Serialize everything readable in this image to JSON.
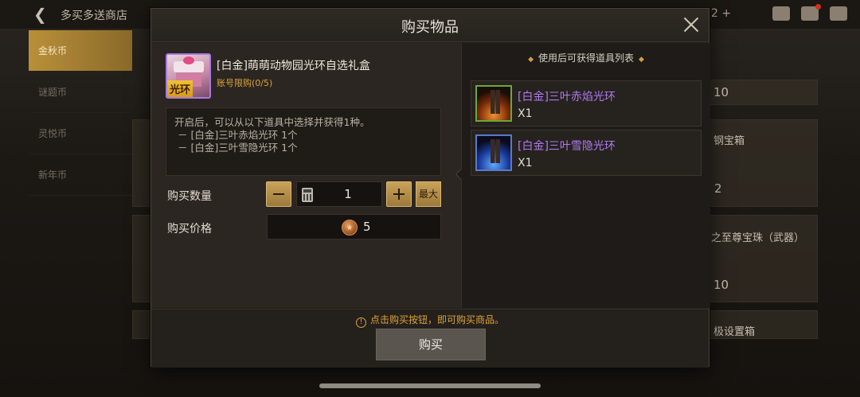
{
  "background": {
    "title": "多买多送商店",
    "top_right_fragment": "2 +",
    "tabs": [
      "金秋币",
      "谜题币",
      "灵悦币",
      "新年币"
    ],
    "cards": {
      "value_1": "10",
      "label_1": "钢宝箱",
      "value_2": "2",
      "label_2": "之至尊宝珠（武器）",
      "value_3": "10",
      "label_3": "极设置箱"
    }
  },
  "dialog": {
    "title": "购买物品",
    "item": {
      "name": "[白金]萌萌动物园光环自选礼盒",
      "tag": "光环",
      "limit": "账号限购(0/5)",
      "description": [
        "开启后，可以从以下道具中选择并获得1种。",
        " － [白金]三叶赤焰光环 1个",
        " － [白金]三叶雪隐光环 1个"
      ]
    },
    "quantity": {
      "label": "购买数量",
      "value": "1",
      "max_label": "最大"
    },
    "price": {
      "label": "购买价格",
      "value": "5"
    },
    "rewards": {
      "title": "使用后可获得道具列表",
      "items": [
        {
          "name": "[白金]三叶赤焰光环",
          "count": "X1",
          "icon": "flame-aura-icon"
        },
        {
          "name": "[白金]三叶雪隐光环",
          "count": "X1",
          "icon": "snow-aura-icon"
        }
      ]
    },
    "notice": "点击购买按钮，即可购买商品。",
    "buy_label": "购买"
  },
  "colors": {
    "accent_gold": "#c9a25a",
    "rarity_purple": "#b07af0",
    "notice_orange": "#dda33a"
  }
}
